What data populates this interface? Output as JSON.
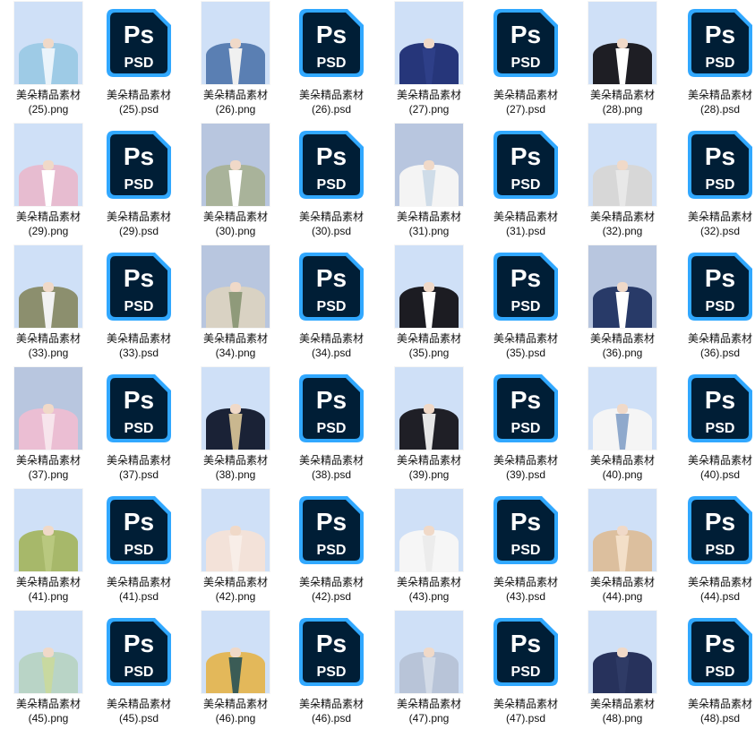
{
  "files": [
    {
      "line1": "美朵精品素材",
      "line2": "(25).png",
      "kind": "png",
      "bg": "#cfe0f7",
      "coat": "#9ecbe6",
      "shirt": "#eaf4fb",
      "neck": "#f0d9c8"
    },
    {
      "line1": "美朵精品素材",
      "line2": "(25).psd",
      "kind": "psd"
    },
    {
      "line1": "美朵精品素材",
      "line2": "(26).png",
      "kind": "png",
      "bg": "#cfe0f7",
      "coat": "#5a7fb3",
      "shirt": "#f0f0f0",
      "neck": "#f0d9c8"
    },
    {
      "line1": "美朵精品素材",
      "line2": "(26).psd",
      "kind": "psd"
    },
    {
      "line1": "美朵精品素材",
      "line2": "(27).png",
      "kind": "png",
      "bg": "#cfe0f7",
      "coat": "#26367a",
      "shirt": "#2e3f88",
      "neck": "#f0d9c8"
    },
    {
      "line1": "美朵精品素材",
      "line2": "(27).psd",
      "kind": "psd"
    },
    {
      "line1": "美朵精品素材",
      "line2": "(28).png",
      "kind": "png",
      "bg": "#cfe0f7",
      "coat": "#1e1e24",
      "shirt": "#ffffff",
      "neck": "#f0d9c8"
    },
    {
      "line1": "美朵精品素材",
      "line2": "(28).psd",
      "kind": "psd"
    },
    {
      "line1": "美朵精品素材",
      "line2": "(29).png",
      "kind": "png",
      "bg": "#cfe0f7",
      "coat": "#e7bcd0",
      "shirt": "#ffffff",
      "neck": "#f0d9c8"
    },
    {
      "line1": "美朵精品素材",
      "line2": "(29).psd",
      "kind": "psd"
    },
    {
      "line1": "美朵精品素材",
      "line2": "(30).png",
      "kind": "png",
      "bg": "#b8c6df",
      "coat": "#a9b39a",
      "shirt": "#ffffff",
      "neck": "#f0d9c8"
    },
    {
      "line1": "美朵精品素材",
      "line2": "(30).psd",
      "kind": "psd"
    },
    {
      "line1": "美朵精品素材",
      "line2": "(31).png",
      "kind": "png",
      "bg": "#b8c6df",
      "coat": "#f4f4f4",
      "shirt": "#cfdce8",
      "neck": "#f0d9c8"
    },
    {
      "line1": "美朵精品素材",
      "line2": "(31).psd",
      "kind": "psd"
    },
    {
      "line1": "美朵精品素材",
      "line2": "(32).png",
      "kind": "png",
      "bg": "#cfe0f7",
      "coat": "#d7d7d7",
      "shirt": "#e8e8e8",
      "neck": "#f0d9c8"
    },
    {
      "line1": "美朵精品素材",
      "line2": "(32).psd",
      "kind": "psd"
    },
    {
      "line1": "美朵精品素材",
      "line2": "(33).png",
      "kind": "png",
      "bg": "#cfe0f7",
      "coat": "#8c8f6e",
      "shirt": "#f2f2f2",
      "neck": "#f0d9c8"
    },
    {
      "line1": "美朵精品素材",
      "line2": "(33).psd",
      "kind": "psd"
    },
    {
      "line1": "美朵精品素材",
      "line2": "(34).png",
      "kind": "png",
      "bg": "#b8c6df",
      "coat": "#d9d2c3",
      "shirt": "#8f9a7a",
      "neck": "#f0d9c8"
    },
    {
      "line1": "美朵精品素材",
      "line2": "(34).psd",
      "kind": "psd"
    },
    {
      "line1": "美朵精品素材",
      "line2": "(35).png",
      "kind": "png",
      "bg": "#cfe0f7",
      "coat": "#1c1c22",
      "shirt": "#ffffff",
      "neck": "#f0d9c8"
    },
    {
      "line1": "美朵精品素材",
      "line2": "(35).psd",
      "kind": "psd"
    },
    {
      "line1": "美朵精品素材",
      "line2": "(36).png",
      "kind": "png",
      "bg": "#b8c6df",
      "coat": "#283a68",
      "shirt": "#ffffff",
      "neck": "#f0d9c8"
    },
    {
      "line1": "美朵精品素材",
      "line2": "(36).psd",
      "kind": "psd"
    },
    {
      "line1": "美朵精品素材",
      "line2": "(37).png",
      "kind": "png",
      "bg": "#b8c6df",
      "coat": "#ebbed3",
      "shirt": "#f7e5ec",
      "neck": "#f0d9c8"
    },
    {
      "line1": "美朵精品素材",
      "line2": "(37).psd",
      "kind": "psd"
    },
    {
      "line1": "美朵精品素材",
      "line2": "(38).png",
      "kind": "png",
      "bg": "#cfe0f7",
      "coat": "#1a2236",
      "shirt": "#c9b78f",
      "neck": "#f0d9c8"
    },
    {
      "line1": "美朵精品素材",
      "line2": "(38).psd",
      "kind": "psd"
    },
    {
      "line1": "美朵精品素材",
      "line2": "(39).png",
      "kind": "png",
      "bg": "#cfe0f7",
      "coat": "#1f1f26",
      "shirt": "#e6e6e6",
      "neck": "#f0d9c8"
    },
    {
      "line1": "美朵精品素材",
      "line2": "(39).psd",
      "kind": "psd"
    },
    {
      "line1": "美朵精品素材",
      "line2": "(40).png",
      "kind": "png",
      "bg": "#cfe0f7",
      "coat": "#f5f5f5",
      "shirt": "#8fa9cc",
      "neck": "#f0d9c8"
    },
    {
      "line1": "美朵精品素材",
      "line2": "(40).psd",
      "kind": "psd"
    },
    {
      "line1": "美朵精品素材",
      "line2": "(41).png",
      "kind": "png",
      "bg": "#cfe0f7",
      "coat": "#a7b86a",
      "shirt": "#b9c87f",
      "neck": "#f0d9c8"
    },
    {
      "line1": "美朵精品素材",
      "line2": "(41).psd",
      "kind": "psd"
    },
    {
      "line1": "美朵精品素材",
      "line2": "(42).png",
      "kind": "png",
      "bg": "#cfe0f7",
      "coat": "#f3e2d9",
      "shirt": "#f8eee8",
      "neck": "#f0d9c8"
    },
    {
      "line1": "美朵精品素材",
      "line2": "(42).psd",
      "kind": "psd"
    },
    {
      "line1": "美朵精品素材",
      "line2": "(43).png",
      "kind": "png",
      "bg": "#cfe0f7",
      "coat": "#f6f6f6",
      "shirt": "#ececec",
      "neck": "#f0d9c8"
    },
    {
      "line1": "美朵精品素材",
      "line2": "(43).psd",
      "kind": "psd"
    },
    {
      "line1": "美朵精品素材",
      "line2": "(44).png",
      "kind": "png",
      "bg": "#cfe0f7",
      "coat": "#dcbf9e",
      "shirt": "#f3dfc8",
      "neck": "#f0d9c8"
    },
    {
      "line1": "美朵精品素材",
      "line2": "(44).psd",
      "kind": "psd"
    },
    {
      "line1": "美朵精品素材",
      "line2": "(45).png",
      "kind": "png",
      "bg": "#cfe0f7",
      "coat": "#b9d4c6",
      "shirt": "#c8d9a0",
      "neck": "#f0d9c8"
    },
    {
      "line1": "美朵精品素材",
      "line2": "(45).psd",
      "kind": "psd"
    },
    {
      "line1": "美朵精品素材",
      "line2": "(46).png",
      "kind": "png",
      "bg": "#cfe0f7",
      "coat": "#e3b85a",
      "shirt": "#3b5c56",
      "neck": "#f0d9c8"
    },
    {
      "line1": "美朵精品素材",
      "line2": "(46).psd",
      "kind": "psd"
    },
    {
      "line1": "美朵精品素材",
      "line2": "(47).png",
      "kind": "png",
      "bg": "#cfe0f7",
      "coat": "#b8c4d8",
      "shirt": "#d3dbe7",
      "neck": "#f0d9c8"
    },
    {
      "line1": "美朵精品素材",
      "line2": "(47).psd",
      "kind": "psd"
    },
    {
      "line1": "美朵精品素材",
      "line2": "(48).png",
      "kind": "png",
      "bg": "#cfe0f7",
      "coat": "#27325c",
      "shirt": "#2f3b66",
      "neck": "#f0d9c8"
    },
    {
      "line1": "美朵精品素材",
      "line2": "(48).psd",
      "kind": "psd"
    }
  ],
  "psd_icon": {
    "top_text": "Ps",
    "bottom_text": "PSD",
    "bg": "#001e36",
    "border": "#31a8ff",
    "text": "#ffffff"
  }
}
